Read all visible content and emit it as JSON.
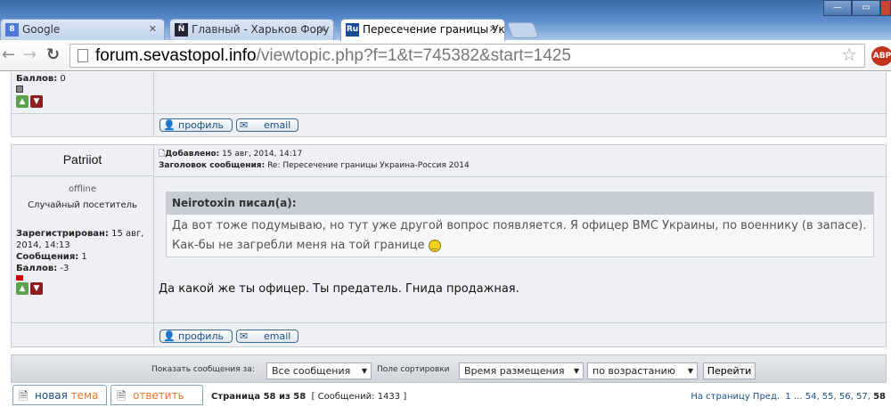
{
  "browser": {
    "tabs": [
      {
        "label": "Google",
        "favicon": "8",
        "active": false
      },
      {
        "label": "Главный - Харьков Фору",
        "favicon": "Ñ",
        "active": false
      },
      {
        "label": "Пересечение границы Ук",
        "favicon": "Ru",
        "active": true
      }
    ],
    "url_host": "forum.sevastopol.info",
    "url_path": "/viewtopic.php?f=1&t=745382&start=1425",
    "abp": "ABP"
  },
  "prev_post": {
    "points_label": "Баллов:",
    "points": "0",
    "profile_btn": "профиль",
    "email_btn": "email"
  },
  "post": {
    "author": "Patriiot",
    "status": "offline",
    "rank": "Случайный посетитель",
    "registered_label": "Зарегистрирован:",
    "registered": "15 авг, 2014, 14:13",
    "messages_label": "Сообщения:",
    "messages": "1",
    "points_label": "Баллов:",
    "points": "-3",
    "added_label": "Добавлено:",
    "added": "15 авг, 2014, 14:17",
    "subject_label": "Заголовок сообщения:",
    "subject": "Re: Пересечение границы Украина-Россия 2014",
    "quote_author": "Neirotoxin писал(а):",
    "quote_text": "Да вот тоже подумываю, но тут уже другой вопрос появляется. Я офицер ВМС Украины, по военнику (в запасе). Как-бы не загребли меня на той границе",
    "body": "Да какой же ты офицер. Ты предатель. Гнида продажная.",
    "profile_btn": "профиль",
    "email_btn": "email"
  },
  "filters": {
    "show_label": "Показать сообщения за:",
    "show_value": "Все сообщения",
    "sort_label": "Поле сортировки",
    "sort_value": "Время размещения",
    "order_value": "по возрастанию",
    "go": "Перейти"
  },
  "footer": {
    "new_topic_a": "новая ",
    "new_topic_b": "тема",
    "reply": "ответить",
    "page_info": "Страница 58 из 58",
    "count": "[ Сообщений: 1433 ]",
    "pager_label": "На страницу",
    "prev": "Пред.",
    "p1": "1",
    "ellipsis": "...",
    "pages": [
      "54",
      "55",
      "56",
      "57",
      "58"
    ]
  }
}
